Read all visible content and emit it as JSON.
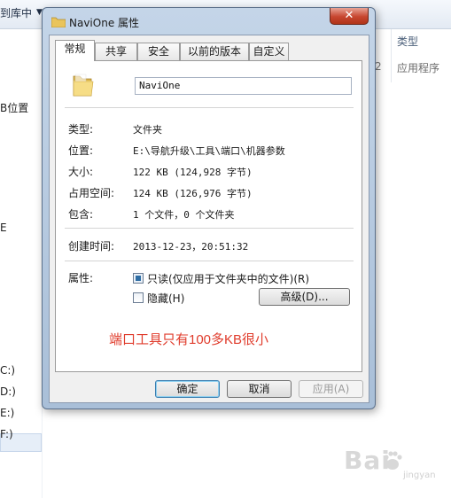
{
  "background": {
    "toolbar_button": "到库中",
    "nav_items": [
      "B位置",
      "E",
      "C:)",
      "D:)",
      "E:)",
      "F:)"
    ],
    "column_header": "类型",
    "row_digit": "2",
    "row_type": "应用程序"
  },
  "watermark": {
    "logo": "Bai",
    "sub": "jingyan"
  },
  "dialog": {
    "title": "NaviOne 属性",
    "close_glyph": "✕",
    "tabs": [
      "常规",
      "共享",
      "安全",
      "以前的版本",
      "自定义"
    ],
    "name_value": "NaviOne",
    "fields": {
      "type_label": "类型:",
      "type_value": "文件夹",
      "location_label": "位置:",
      "location_value": "E:\\导航升级\\工具\\端口\\机器参数",
      "size_label": "大小:",
      "size_value": "122 KB (124,928 字节)",
      "disk_label": "占用空间:",
      "disk_value": "124 KB (126,976 字节)",
      "contains_label": "包含:",
      "contains_value": "1 个文件，0 个文件夹",
      "created_label": "创建时间:",
      "created_value": "2013-12-23，20:51:32"
    },
    "attributes": {
      "label": "属性:",
      "readonly_label": "只读(仅应用于文件夹中的文件)(R)",
      "readonly_checked": true,
      "hidden_label": "隐藏(H)",
      "hidden_checked": false,
      "advanced_button": "高级(D)..."
    },
    "annotation": "端口工具只有100多KB很小",
    "buttons": {
      "ok": "确定",
      "cancel": "取消",
      "apply": "应用(A)"
    }
  },
  "colors": {
    "annotation": "#e03c2c",
    "close_button": "#c7462f",
    "accent": "#3c7fb1"
  }
}
